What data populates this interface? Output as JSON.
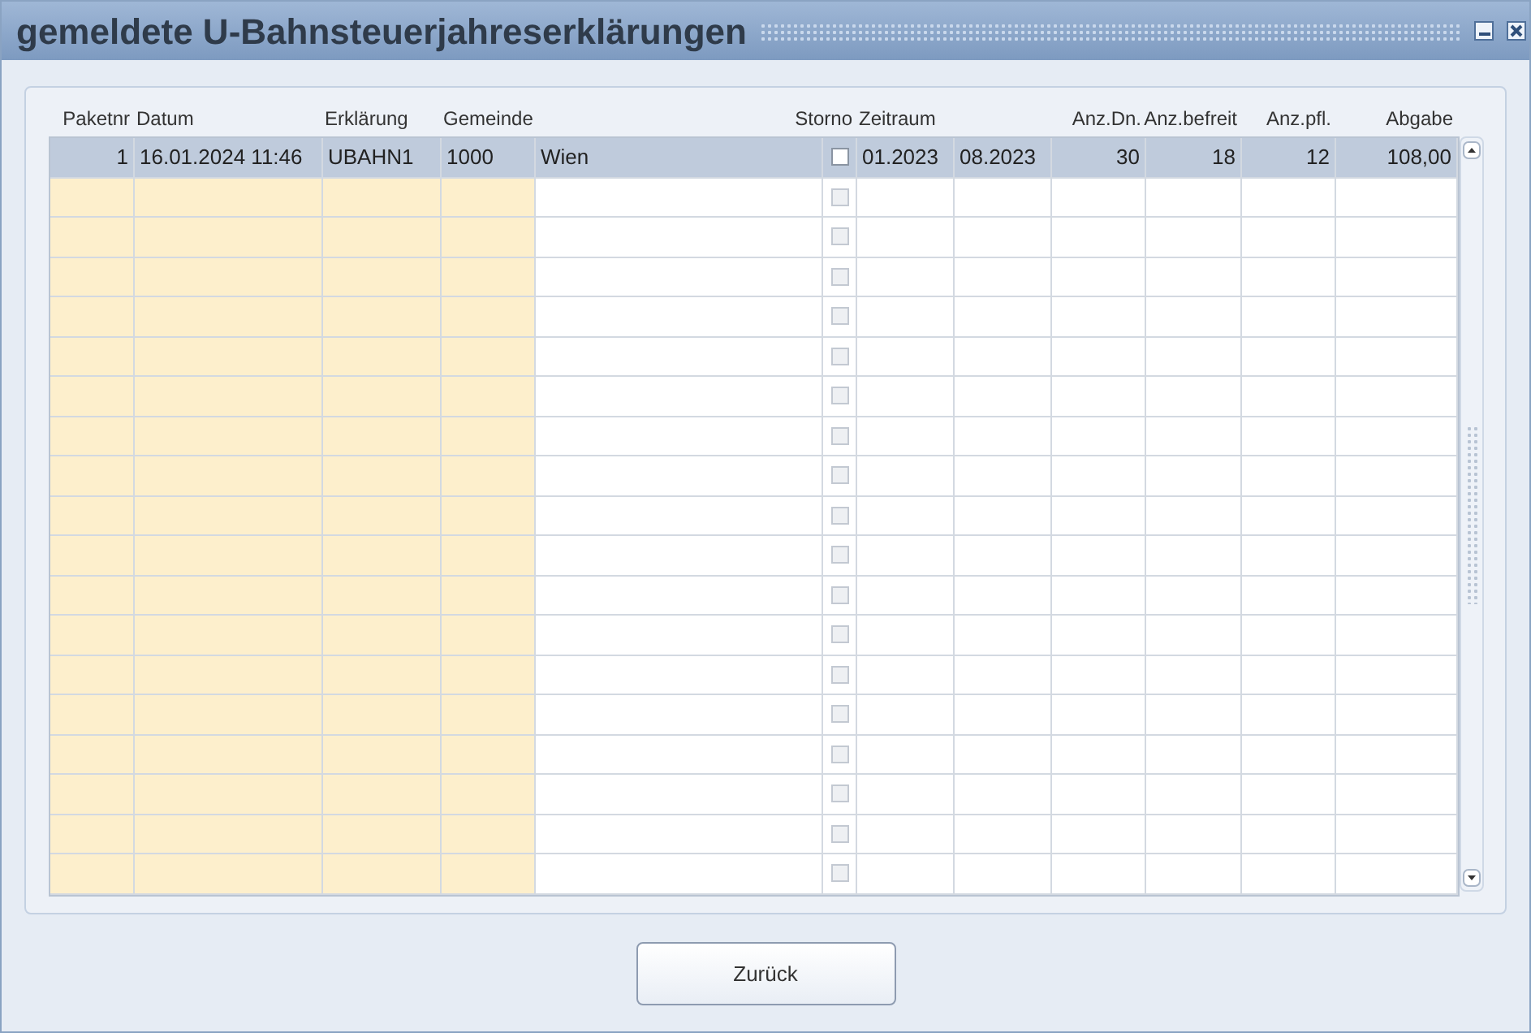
{
  "window": {
    "title": "gemeldete U-Bahnsteuerjahreserklärungen"
  },
  "table": {
    "columns": [
      {
        "label": "Paketnr",
        "kind": "number",
        "required": true
      },
      {
        "label": "Datum",
        "kind": "text",
        "required": true
      },
      {
        "label": "Erklärung",
        "kind": "text",
        "required": true
      },
      {
        "label": "Gemeinde",
        "kind": "text",
        "required": true
      },
      {
        "kind": "text",
        "required": false
      },
      {
        "label": "Storno",
        "kind": "check",
        "required": false
      },
      {
        "label": "Zeitraum",
        "kind": "text",
        "required": false
      },
      {
        "kind": "text",
        "required": false
      },
      {
        "label": "Anz.Dn.",
        "kind": "number",
        "required": false
      },
      {
        "label": "Anz.befreit",
        "kind": "number",
        "required": false
      },
      {
        "label": "Anz.pfl.",
        "kind": "number",
        "required": false
      },
      {
        "label": "Abgabe",
        "kind": "number",
        "required": false
      }
    ],
    "rows": [
      {
        "selected": true,
        "disabled": false,
        "storno": false,
        "cells": [
          "1",
          "16.01.2024 11:46",
          "UBAHN1",
          "1000",
          "Wien",
          null,
          "01.2023",
          "08.2023",
          "30",
          "18",
          "12",
          "108,00"
        ]
      },
      {
        "selected": false,
        "disabled": true,
        "storno": false
      },
      {
        "selected": false,
        "disabled": true,
        "storno": false
      },
      {
        "selected": false,
        "disabled": true,
        "storno": false
      },
      {
        "selected": false,
        "disabled": true,
        "storno": false
      },
      {
        "selected": false,
        "disabled": true,
        "storno": false
      },
      {
        "selected": false,
        "disabled": true,
        "storno": false
      },
      {
        "selected": false,
        "disabled": true,
        "storno": false
      },
      {
        "selected": false,
        "disabled": true,
        "storno": false
      },
      {
        "selected": false,
        "disabled": true,
        "storno": false
      },
      {
        "selected": false,
        "disabled": true,
        "storno": false
      },
      {
        "selected": false,
        "disabled": true,
        "storno": false
      },
      {
        "selected": false,
        "disabled": true,
        "storno": false
      },
      {
        "selected": false,
        "disabled": true,
        "storno": false
      },
      {
        "selected": false,
        "disabled": true,
        "storno": false
      },
      {
        "selected": false,
        "disabled": true,
        "storno": false
      },
      {
        "selected": false,
        "disabled": true,
        "storno": false
      },
      {
        "selected": false,
        "disabled": true,
        "storno": false
      },
      {
        "selected": false,
        "disabled": true,
        "storno": false
      }
    ]
  },
  "buttons": [
    {
      "label": "Zurück"
    }
  ]
}
